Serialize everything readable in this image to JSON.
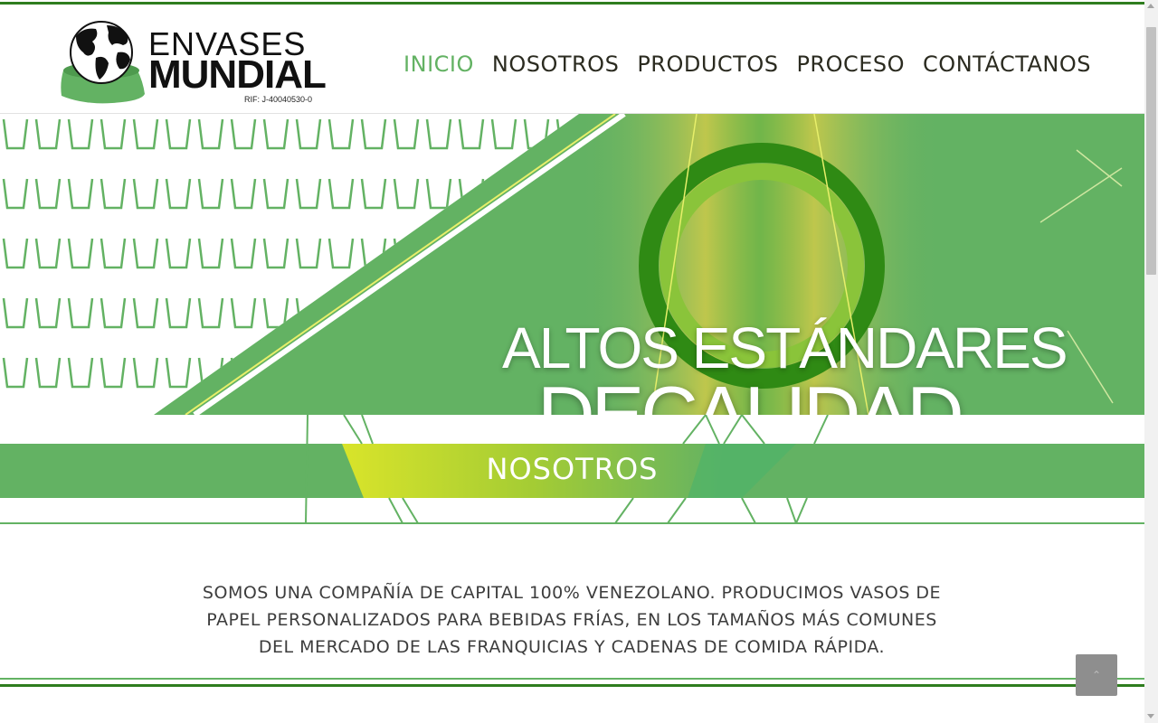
{
  "brand": {
    "line1": "ENVASES",
    "line2": "MUNDIAL",
    "rif": "RIF: J-40040530-0"
  },
  "nav": {
    "items": [
      {
        "label": "INICIO",
        "active": true
      },
      {
        "label": "NOSOTROS",
        "active": false
      },
      {
        "label": "PRODUCTOS",
        "active": false
      },
      {
        "label": "PROCESO",
        "active": false
      },
      {
        "label": "CONTÁCTANOS",
        "active": false
      }
    ]
  },
  "hero": {
    "line1": "ALTOS  ESTÁNDARES",
    "line2": "DECALIDAD"
  },
  "section": {
    "title": "NOSOTROS",
    "text": "SOMOS UNA COMPAÑÍA DE CAPITAL 100% VENEZOLANO. PRODUCIMOS VASOS DE PAPEL PERSONALIZADOS PARA BEBIDAS FRÍAS, EN LOS TAMAÑOS MÁS COMUNES DEL MERCADO DE LAS FRANQUICIAS Y CADENAS DE COMIDA RÁPIDA."
  },
  "colors": {
    "accent": "#63b263",
    "dark_green": "#2e7d1e",
    "yellow_green": "#d4e02a",
    "text": "#3d3d3d"
  },
  "icons": {
    "logo": "globe-cup-icon",
    "back_to_top": "chevron-up-icon"
  }
}
